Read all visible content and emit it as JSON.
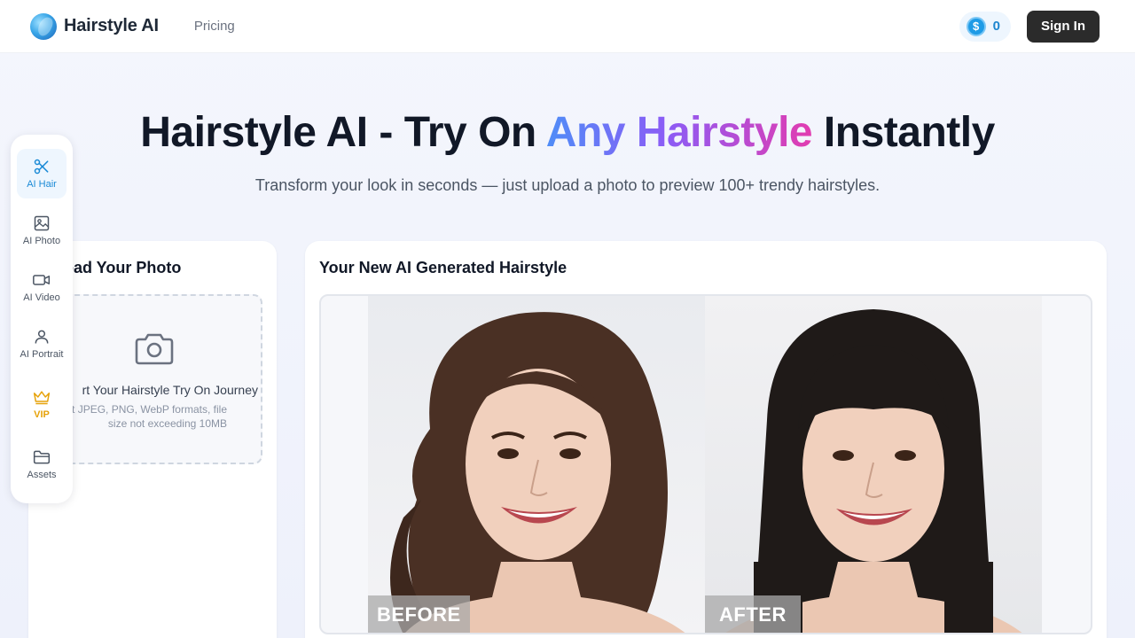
{
  "header": {
    "brand": "Hairstyle AI",
    "nav_pricing": "Pricing",
    "credits": "0",
    "coin_symbol": "$",
    "signin_label": "Sign In"
  },
  "hero": {
    "title_prefix": "Hairstyle AI - Try On ",
    "title_highlight": "Any Hairstyle",
    "title_suffix": " Instantly",
    "subtitle": "Transform your look in seconds — just upload a photo to preview 100+ trendy hairstyles."
  },
  "upload_card": {
    "title": "oad Your Photo",
    "main_text": "rt Your Hairstyle Try On Journey",
    "hint_line1": "port JPEG, PNG, WebP formats, file",
    "hint_line2": "size not exceeding 10MB"
  },
  "result_card": {
    "title": "Your New AI Generated Hairstyle",
    "before_label": "BEFORE",
    "after_label": "AFTER"
  },
  "sidebar": {
    "items": [
      {
        "label": "AI Hair",
        "icon": "scissors-icon",
        "active": true
      },
      {
        "label": "AI Photo",
        "icon": "image-icon"
      },
      {
        "label": "AI Video",
        "icon": "video-icon"
      },
      {
        "label": "AI Portrait",
        "icon": "person-icon"
      },
      {
        "label": "VIP",
        "icon": "crown-icon"
      },
      {
        "label": "Assets",
        "icon": "folder-icon"
      }
    ]
  },
  "colors": {
    "accent_blue": "#1a8ad6",
    "vip_gold": "#e6a20a",
    "signin_bg": "#2b2b2b",
    "gradient_start": "#4f8df7",
    "gradient_mid": "#8b5cf6",
    "gradient_end": "#e23cb0"
  }
}
